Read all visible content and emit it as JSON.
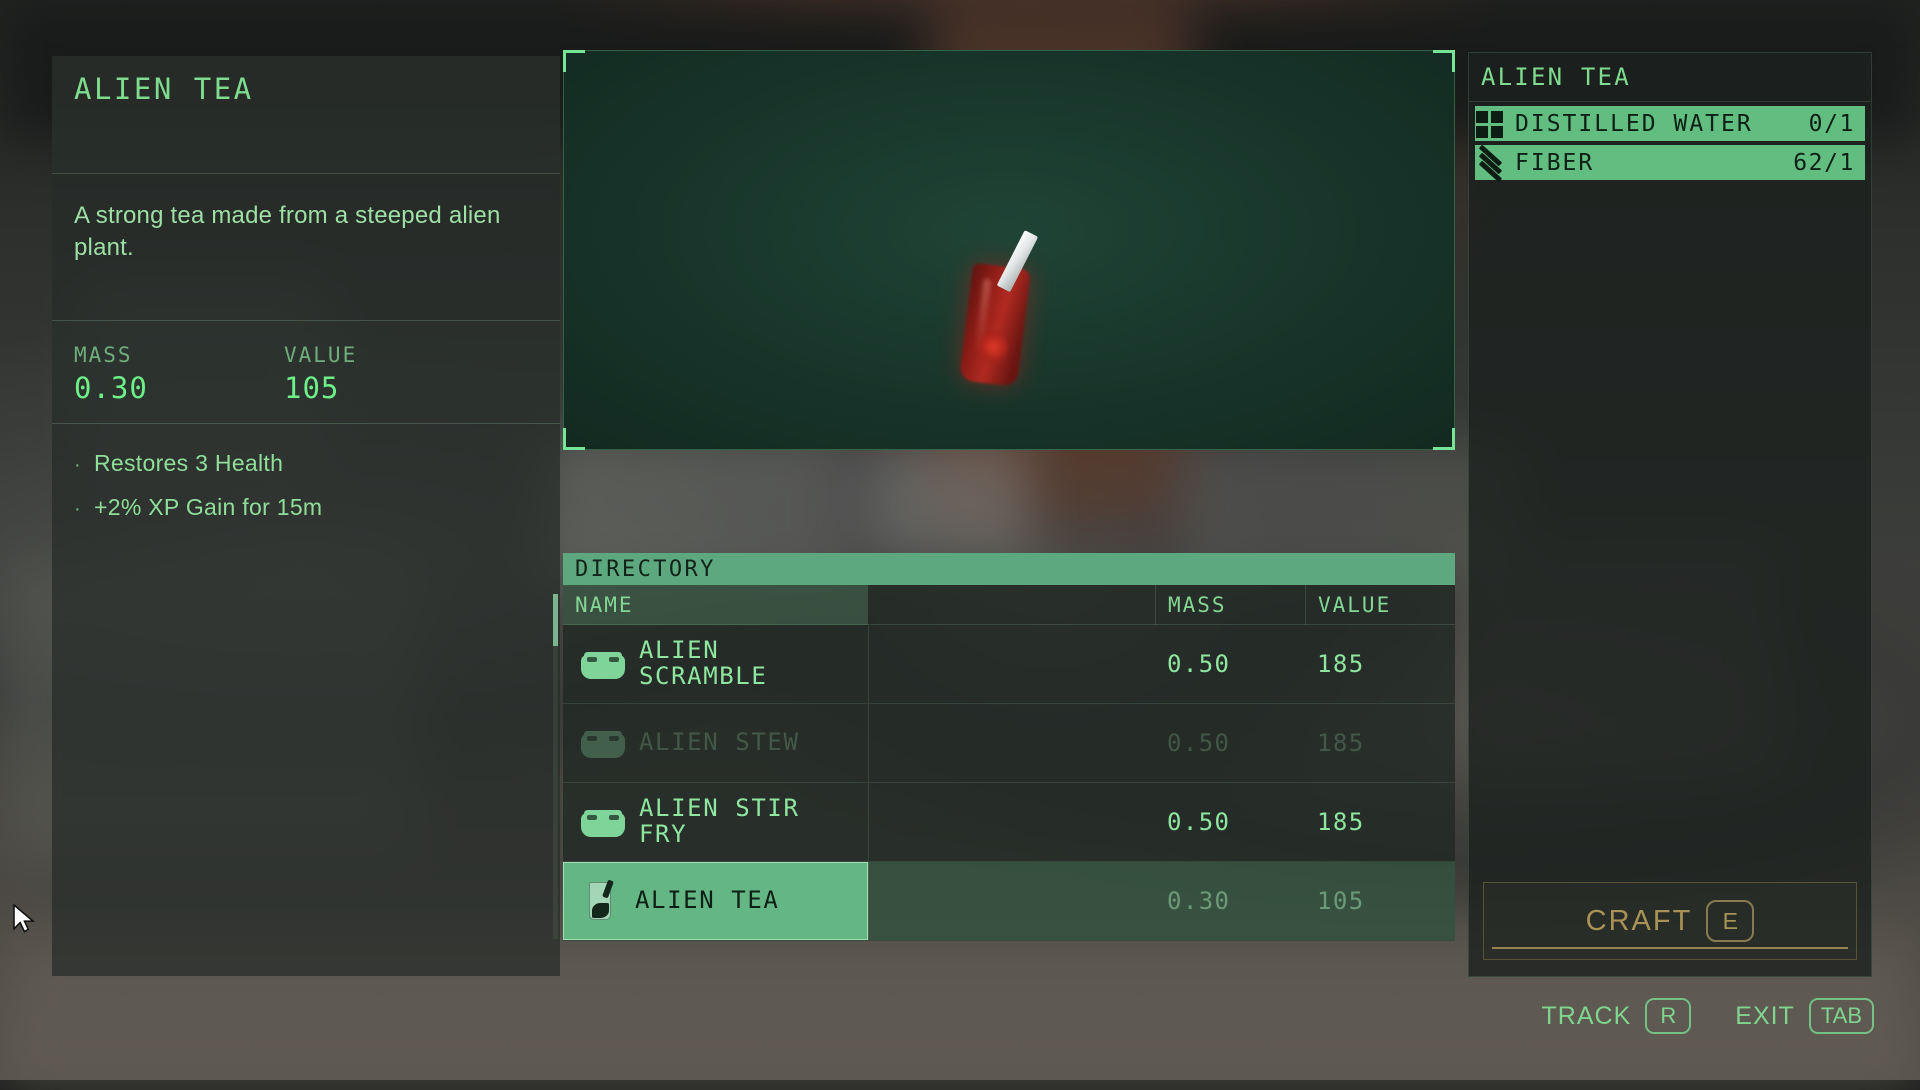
{
  "item_detail": {
    "title": "ALIEN TEA",
    "description": "A strong tea made from a steeped alien plant.",
    "mass_label": "MASS",
    "mass_value": "0.30",
    "value_label": "VALUE",
    "value_value": "105",
    "bullet": "·",
    "effects": [
      "Restores 3 Health",
      "+2% XP Gain for 15m"
    ]
  },
  "preview": {
    "model_name": "alien-tea-pouch"
  },
  "directory": {
    "header_label": "DIRECTORY",
    "columns": {
      "name": "NAME",
      "mass": "MASS",
      "value": "VALUE"
    },
    "rows": [
      {
        "name": "ALIEN SCRAMBLE",
        "name_line1": "ALIEN",
        "name_line2": "SCRAMBLE",
        "mass": "0.50",
        "value": "185",
        "icon": "food-container-icon",
        "state": "normal"
      },
      {
        "name": "ALIEN STEW",
        "name_line1": "ALIEN STEW",
        "name_line2": "",
        "mass": "0.50",
        "value": "185",
        "icon": "food-container-icon",
        "state": "dimmed"
      },
      {
        "name": "ALIEN STIR FRY",
        "name_line1": "ALIEN STIR",
        "name_line2": "FRY",
        "mass": "0.50",
        "value": "185",
        "icon": "food-container-icon",
        "state": "normal"
      },
      {
        "name": "ALIEN TEA",
        "name_line1": "ALIEN TEA",
        "name_line2": "",
        "mass": "0.30",
        "value": "105",
        "icon": "tea-cup-icon",
        "state": "selected"
      }
    ]
  },
  "recipe": {
    "title": "ALIEN TEA",
    "ingredients": [
      {
        "name": "DISTILLED WATER",
        "count": "0/1",
        "icon": "water-squares-icon"
      },
      {
        "name": "FIBER",
        "count": "62/1",
        "icon": "fiber-bars-icon"
      }
    ],
    "craft_label": "CRAFT",
    "craft_key": "E"
  },
  "footer": {
    "track_label": "TRACK",
    "track_key": "R",
    "exit_label": "EXIT",
    "exit_key": "TAB"
  },
  "colors": {
    "accent_green": "#7fdc8f",
    "bright_green": "#6ef089",
    "highlight_bg": "#62bd81",
    "directory_header_bg": "#5da87f",
    "craft_gold": "#a89256",
    "preview_bg": "#173329"
  }
}
